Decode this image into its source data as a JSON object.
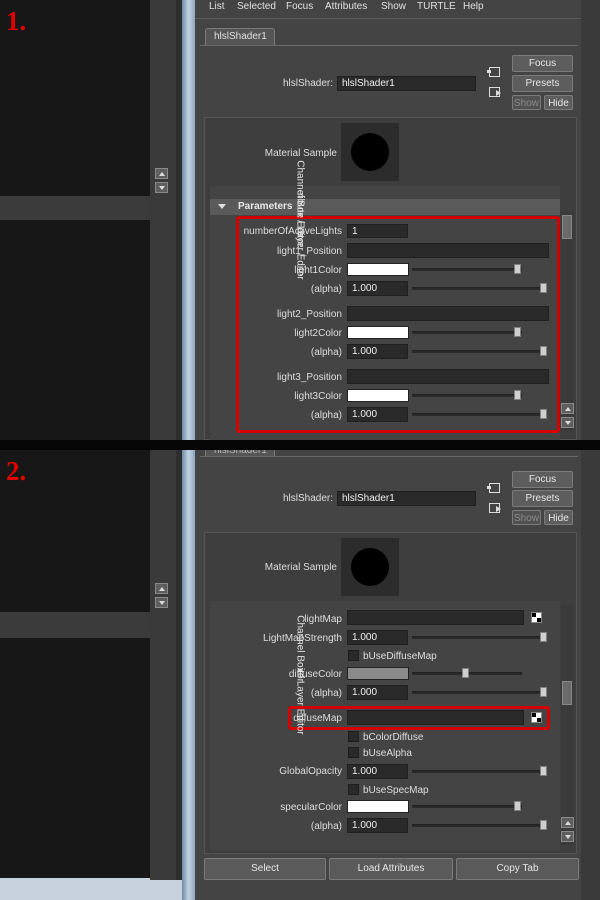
{
  "step_labels": [
    "1.",
    "2."
  ],
  "menu": [
    "List",
    "Selected",
    "Focus",
    "Attributes",
    "Show",
    "TURTLE",
    "Help"
  ],
  "side_tabs": {
    "attribute_editor": "ribute Editor",
    "attribute_editor_short": "itor",
    "channel_box": "Channel Box / Layer Editor"
  },
  "node_tab": "hlslShader1",
  "node_tab_partial": "hlslShader1",
  "shader_label": "hlslShader:",
  "shader_value": "hlslShader1",
  "buttons": {
    "focus": "Focus",
    "presets": "Presets",
    "show": "Show",
    "hide": "Hide",
    "select": "Select",
    "load_attributes": "Load Attributes",
    "copy_tab": "Copy Tab"
  },
  "material_sample": "Material Sample",
  "parameters_header": "Parameters",
  "panel1": {
    "numberOfActiveLights": {
      "label": "numberOfActiveLights",
      "value": "1"
    },
    "light1_position": "light1_Position",
    "light1_color": "light1Color",
    "light1_alpha": {
      "label": "(alpha)",
      "value": "1.000"
    },
    "light2_position": "light2_Position",
    "light2_color": "light2Color",
    "light2_alpha": {
      "label": "(alpha)",
      "value": "1.000"
    },
    "light3_position": "light3_Position",
    "light3_color": "light3Color",
    "light3_alpha": {
      "label": "(alpha)",
      "value": "1.000"
    }
  },
  "panel2": {
    "lightMap": "lightMap",
    "lightMapStrength": {
      "label": "LightMapStrength",
      "value": "1.000"
    },
    "bUseDiffuseMap": "bUseDiffuseMap",
    "diffuseColor": "diffuseColor",
    "diffuse_alpha": {
      "label": "(alpha)",
      "value": "1.000"
    },
    "diffuseMap": "diffuseMap",
    "bColorDiffuse": "bColorDiffuse",
    "bUseAlpha": "bUseAlpha",
    "globalOpacity": {
      "label": "GlobalOpacity",
      "value": "1.000"
    },
    "bUseSpecMap": "bUseSpecMap",
    "specularColor": "specularColor",
    "specular_alpha": {
      "label": "(alpha)",
      "value": "1.000"
    }
  },
  "colors": {
    "highlight": "#d50000",
    "swatch_white": "#ffffff",
    "swatch_gray": "#8a8a8a"
  }
}
